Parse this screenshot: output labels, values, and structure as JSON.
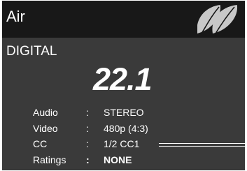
{
  "source": {
    "name": "Air",
    "icon": "leaf-icon"
  },
  "broadcast": {
    "type": "DIGITAL"
  },
  "channel": {
    "number": "22.1"
  },
  "info": {
    "separator": ":",
    "rows": [
      {
        "label": "Audio",
        "value": "STEREO"
      },
      {
        "label": "Video",
        "value": "480p (4:3)"
      },
      {
        "label": "CC",
        "value": "1/2 CC1"
      },
      {
        "label": "Ratings",
        "value": "NONE"
      }
    ]
  },
  "colors": {
    "panel_background": "#3a3a3a",
    "header_background": "#181818",
    "text": "#ffffff",
    "leaf_icon": "#c8c8c8"
  }
}
